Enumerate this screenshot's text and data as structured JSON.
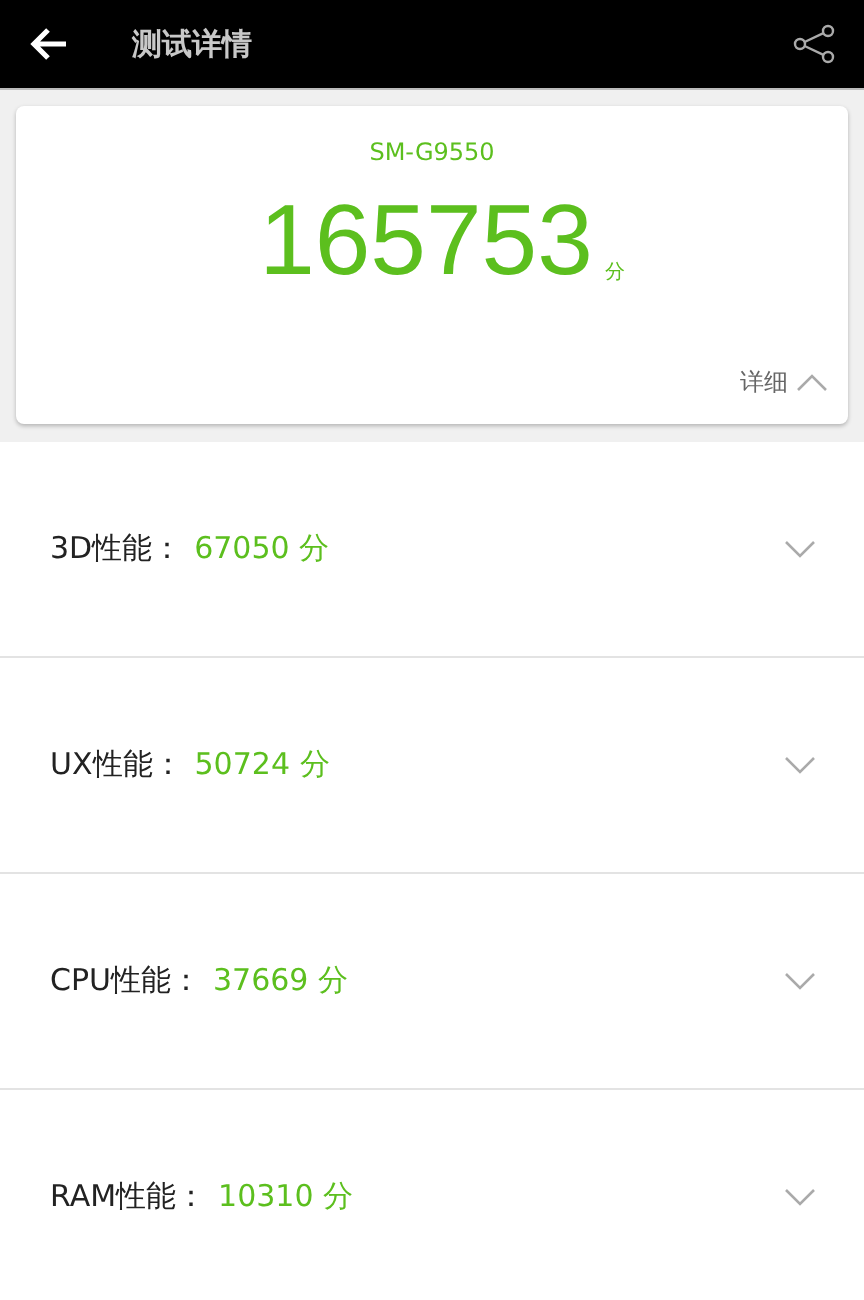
{
  "header": {
    "title": "测试详情"
  },
  "summary": {
    "device": "SM-G9550",
    "score": "165753",
    "unit": "分",
    "details_label": "详细",
    "expanded": true
  },
  "categories": [
    {
      "label": "3D性能：",
      "score": "67050 分",
      "expanded": false
    },
    {
      "label": "UX性能：",
      "score": "50724 分",
      "expanded": false
    },
    {
      "label": "CPU性能：",
      "score": "37669 分",
      "expanded": false
    },
    {
      "label": "RAM性能：",
      "score": "10310 分",
      "expanded": false
    }
  ]
}
